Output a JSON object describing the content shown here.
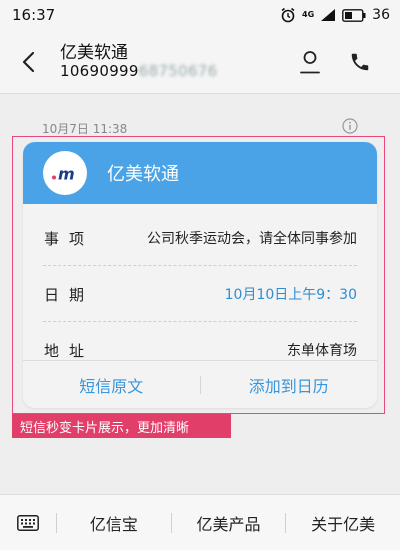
{
  "status_bar": {
    "time": "16:37",
    "network": "4G",
    "battery": "36"
  },
  "header": {
    "contact_name": "亿美软通",
    "number_visible": "10690999",
    "number_blurred": "68750676"
  },
  "message": {
    "timestamp": "10月7日 11:38"
  },
  "card": {
    "title": "亿美软通",
    "logo_text": ".m",
    "header_color": "#4aa3e6",
    "rows": [
      {
        "label": "事项",
        "value": "公司秋季运动会，请全体同事参加"
      },
      {
        "label": "日期",
        "value": "10月10日上午9：30"
      },
      {
        "label": "地址",
        "value": "东单体育场"
      }
    ],
    "actions": {
      "original": "短信原文",
      "add_calendar": "添加到日历"
    }
  },
  "promo": {
    "text": "短信秒变卡片展示，更加清晰",
    "color": "#e23e6a"
  },
  "bottom_menu": {
    "items": [
      "亿信宝",
      "亿美产品",
      "关于亿美"
    ]
  }
}
